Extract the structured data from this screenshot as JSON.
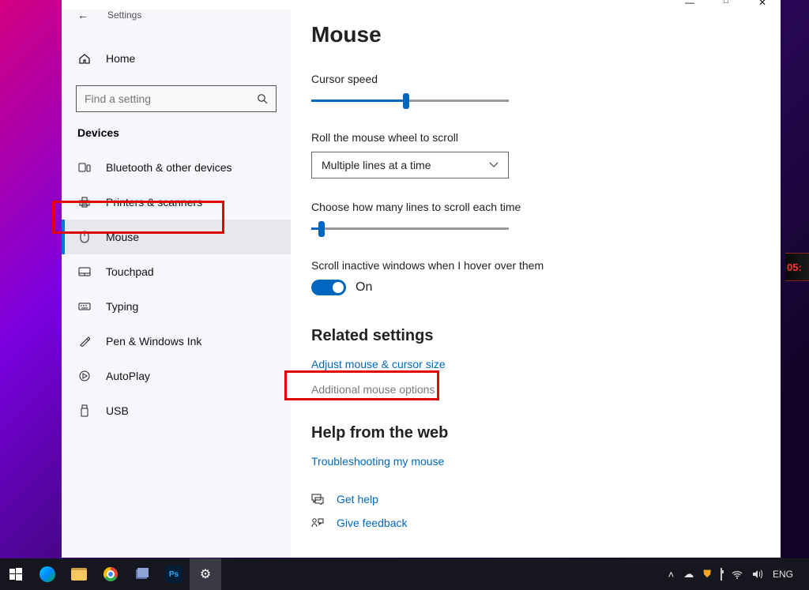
{
  "window": {
    "app": "Settings",
    "minimize": "—",
    "maximize": "□",
    "close": "✕"
  },
  "sidebar": {
    "home": "Home",
    "search_placeholder": "Find a setting",
    "section": "Devices",
    "items": [
      {
        "label": "Bluetooth & other devices"
      },
      {
        "label": "Printers & scanners"
      },
      {
        "label": "Mouse"
      },
      {
        "label": "Touchpad"
      },
      {
        "label": "Typing"
      },
      {
        "label": "Pen & Windows Ink"
      },
      {
        "label": "AutoPlay"
      },
      {
        "label": "USB"
      }
    ]
  },
  "main": {
    "title": "Mouse",
    "cursor_speed_label": "Cursor speed",
    "cursor_speed_percent": 48,
    "roll_label": "Roll the mouse wheel to scroll",
    "roll_value": "Multiple lines at a time",
    "lines_label": "Choose how many lines to scroll each time",
    "lines_percent": 5,
    "inactive_label": "Scroll inactive windows when I hover over them",
    "inactive_value": "On",
    "related_heading": "Related settings",
    "related_links": [
      "Adjust mouse & cursor size",
      "Additional mouse options"
    ],
    "help_heading": "Help from the web",
    "help_links": [
      "Troubleshooting my mouse"
    ],
    "get_help": "Get help",
    "give_feedback": "Give feedback"
  },
  "taskbar": {
    "ps_label": "Ps",
    "tray": {
      "lang": "ENG"
    }
  },
  "desktop_clock_partial": "05:"
}
